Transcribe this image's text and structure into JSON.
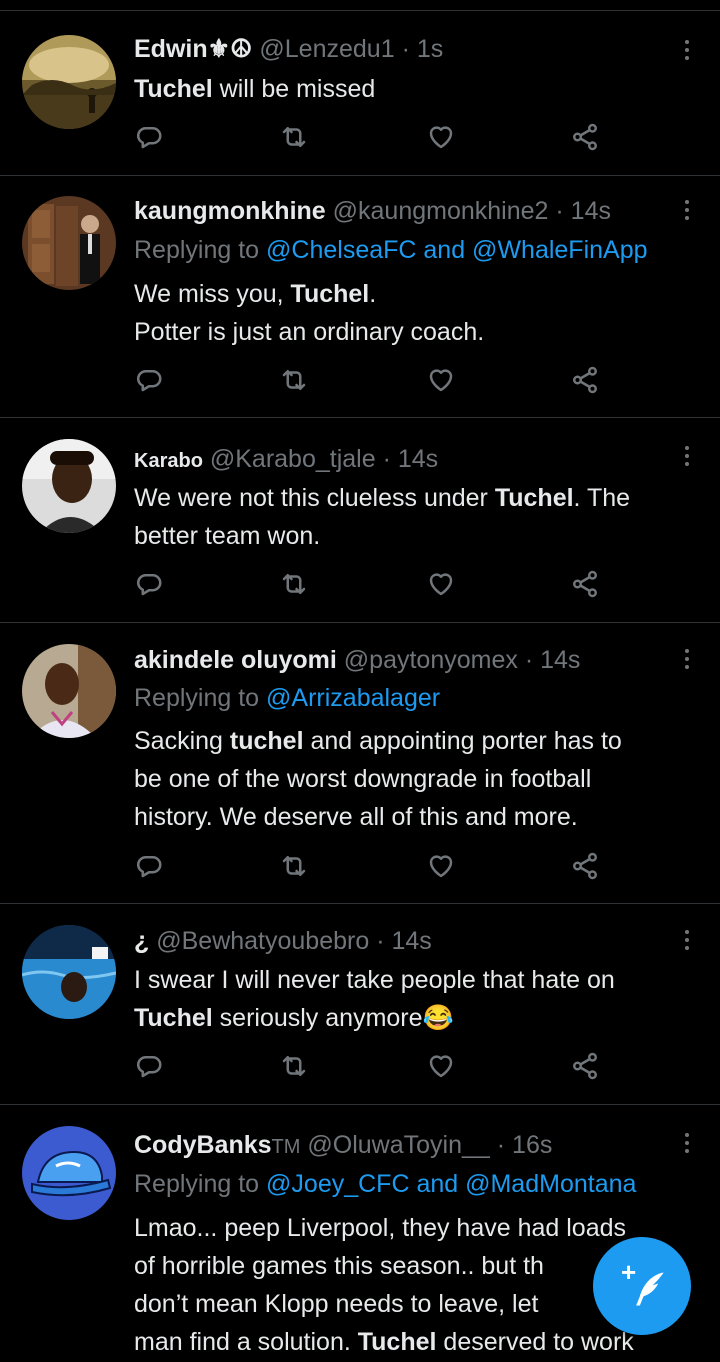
{
  "colors": {
    "background": "#000000",
    "text": "#e7e9ea",
    "muted": "#71767b",
    "accent": "#1d9bf0",
    "divider": "#2f3336"
  },
  "action_icons": [
    "reply-icon",
    "retweet-icon",
    "like-icon",
    "share-icon"
  ],
  "tweets": [
    {
      "name": "Edwin⚜☮",
      "handle": "@Lenzedu1",
      "dot": "·",
      "time": "1s",
      "replying": null,
      "lines": [
        [
          "Tuchel",
          " will be missed"
        ]
      ]
    },
    {
      "name": "kaungmonkhine",
      "handle": "@kaungmonkhine2",
      "dot": "·",
      "time": "14s",
      "replying": {
        "prefix": "Replying to ",
        "mentions": "@ChelseaFC and @WhaleFinApp"
      },
      "lines": [
        [
          "We miss you, ",
          "Tuchel",
          "."
        ],
        [
          "Potter is just an ordinary coach."
        ]
      ]
    },
    {
      "name": "Karabo",
      "handle": "@Karabo_tjale",
      "dot": "·",
      "time": "14s",
      "replying": null,
      "lines": [
        [
          "We were not this clueless under ",
          "Tuchel",
          ". The"
        ],
        [
          "better team won."
        ]
      ]
    },
    {
      "name": "akindele oluyomi",
      "handle": "@paytonyomex",
      "dot": "·",
      "time": "14s",
      "replying": {
        "prefix": "Replying to ",
        "mentions": "@Arrizabalager"
      },
      "lines": [
        [
          "Sacking ",
          "tuchel",
          " and appointing porter has to"
        ],
        [
          "be one of the worst downgrade in football"
        ],
        [
          "history. We deserve all of this and more."
        ]
      ]
    },
    {
      "name": "¿",
      "handle": "@Bewhatyoubebro",
      "dot": "·",
      "time": "14s",
      "replying": null,
      "lines": [
        [
          "I swear I will never take people that hate on"
        ],
        [
          "",
          "Tuchel",
          " seriously anymore😂"
        ]
      ]
    },
    {
      "name": "CodyBanks",
      "name_suffix": "TM",
      "handle": "@OluwaToyin__",
      "dot": "·",
      "time": "16s",
      "replying": {
        "prefix": "Replying to ",
        "mentions": "@Joey_CFC and @MadMontana"
      },
      "lines": [
        [
          "Lmao... peep Liverpool, they have had loads"
        ],
        [
          "of horrible games this season.. but th"
        ],
        [
          "don’t mean Klopp needs to leave, let"
        ],
        [
          "man find a solution. ",
          "Tuchel",
          " deserved to work"
        ]
      ]
    }
  ],
  "compose": {
    "label": "+"
  }
}
